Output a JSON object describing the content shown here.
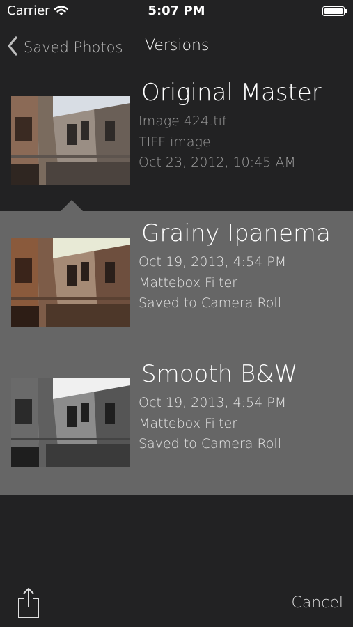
{
  "status_bar": {
    "carrier": "Carrier",
    "time": "5:07 PM",
    "wifi_icon": "wifi-icon",
    "battery_icon": "battery-icon"
  },
  "nav": {
    "back_label": "Saved Photos",
    "title": "Versions",
    "back_icon": "chevron-left-icon"
  },
  "versions": [
    {
      "title": "Original Master",
      "lines": [
        "Image 424.tif",
        "TIFF image",
        "Oct 23, 2012, 10:45 AM"
      ],
      "tint": "original"
    },
    {
      "title": "Grainy Ipanema",
      "lines": [
        "Oct 19, 2013, 4:54 PM",
        "Mattebox Filter",
        "Saved to Camera Roll"
      ],
      "tint": "sepia"
    },
    {
      "title": "Smooth B&W",
      "lines": [
        "Oct 19, 2013, 4:54 PM",
        "Mattebox Filter",
        "Saved to Camera Roll"
      ],
      "tint": "bw"
    }
  ],
  "toolbar": {
    "share_icon": "share-icon",
    "cancel_label": "Cancel"
  },
  "colors": {
    "background": "#222223",
    "selected_panel": "#666666",
    "secondary_text": "#9b9b9b"
  }
}
